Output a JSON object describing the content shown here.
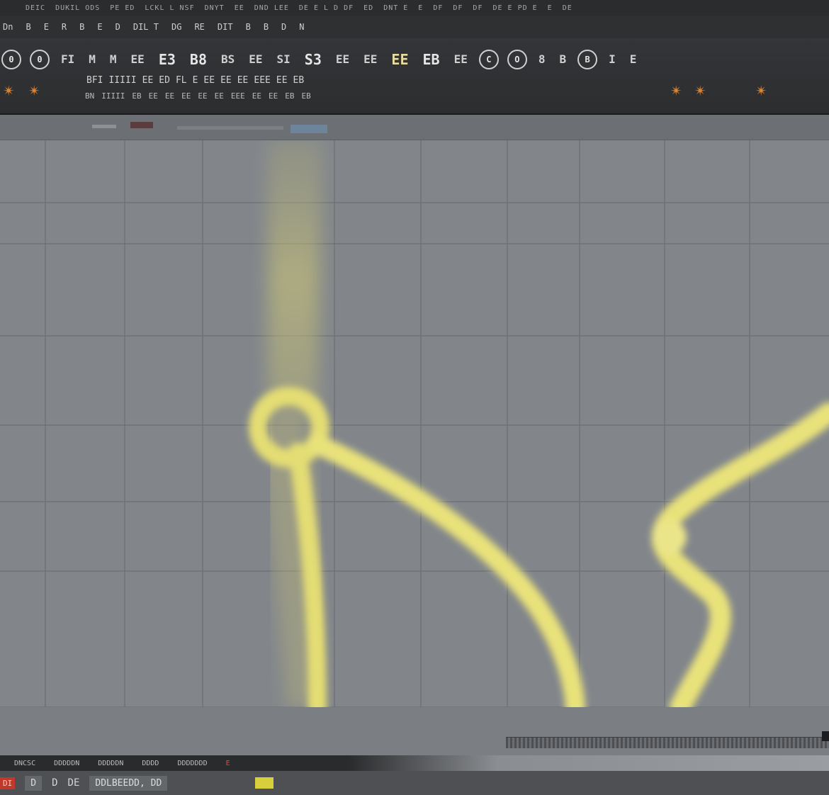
{
  "menubar": {
    "items": [
      "DEIC",
      "DUKIL ODS",
      "PE ED",
      "LCKL L NSF",
      "DNYT",
      "EE",
      "DND LEE",
      "DE E L D DF",
      "ED",
      "DNT E",
      "E",
      "DF",
      "DF",
      "DF",
      "DE E PD E",
      "E",
      "DE"
    ]
  },
  "subbar": {
    "items": [
      "Dn",
      "B",
      "E",
      "R",
      "B",
      "E",
      "D",
      "DIL T",
      "DG",
      "RE",
      "DIT",
      "B",
      "B",
      "D",
      "N"
    ]
  },
  "toolbar": {
    "row1": [
      {
        "label": "0",
        "icon": "circle-tool-icon",
        "style": "round"
      },
      {
        "label": "0",
        "icon": "circle-tool-icon",
        "style": "round"
      },
      {
        "label": "FI",
        "icon": "f-tool-icon",
        "style": "small"
      },
      {
        "label": "M",
        "icon": "m-tool-icon",
        "style": "small"
      },
      {
        "label": "M",
        "icon": "m-tool-icon",
        "style": "small"
      },
      {
        "label": "EE",
        "icon": "grid-tool-icon",
        "style": "small"
      },
      {
        "label": "E3",
        "icon": "e3-tool-icon",
        "style": "big"
      },
      {
        "label": "B8",
        "icon": "b8-tool-icon",
        "style": "big"
      },
      {
        "label": "BS",
        "icon": "bs-tool-icon",
        "style": "small"
      },
      {
        "label": "EE",
        "icon": "grid-tool-icon",
        "style": "small"
      },
      {
        "label": "SI",
        "icon": "si-tool-icon",
        "style": "small"
      },
      {
        "label": "S3",
        "icon": "s3-tool-icon",
        "style": "big"
      },
      {
        "label": "EE",
        "icon": "grid-tool-icon",
        "style": "small"
      },
      {
        "label": "EE",
        "icon": "grid-tool-icon",
        "style": "small"
      },
      {
        "label": "EE",
        "icon": "grid-tool-icon",
        "style": "warm"
      },
      {
        "label": "EB",
        "icon": "eb-tool-icon",
        "style": "big"
      },
      {
        "label": "EE",
        "icon": "grid-tool-icon",
        "style": "small"
      },
      {
        "label": "C",
        "icon": "c-tool-icon",
        "style": "round"
      },
      {
        "label": "O",
        "icon": "o-tool-icon",
        "style": "round"
      },
      {
        "label": "8",
        "icon": "eight-tool-icon",
        "style": "small"
      },
      {
        "label": "B",
        "icon": "b-tool-icon",
        "style": "small"
      },
      {
        "label": "B",
        "icon": "b-tool-icon",
        "style": "round"
      },
      {
        "label": "I",
        "icon": "i-tool-icon",
        "style": "small"
      },
      {
        "label": "E",
        "icon": "e-tool-icon",
        "style": "small"
      }
    ],
    "row2": [
      "BFI",
      "IIIII",
      "EE",
      "ED",
      "FL",
      "E",
      "EE",
      "EE",
      "EE",
      "EEE",
      "EE",
      "EB"
    ],
    "row3": [
      "BN",
      "IIIII",
      "EB",
      "EE",
      "EE",
      "EE",
      "EE",
      "EE",
      "EEE",
      "EE",
      "EE",
      "EB",
      "EB"
    ]
  },
  "viewport": {
    "grid_color": "#6e7176",
    "background": "#82868b",
    "curve_color": "#e9e27a"
  },
  "status_bar": {
    "items": [
      "DNCSC",
      "DDDDDN",
      "DDDDDN",
      "DDDD",
      "DDDDDDD",
      "E"
    ]
  },
  "bottom_row": {
    "red_chip": "DI",
    "field_labels": [
      "D",
      "D",
      "DE"
    ],
    "input_value": "DDLBEEDD, DD"
  }
}
